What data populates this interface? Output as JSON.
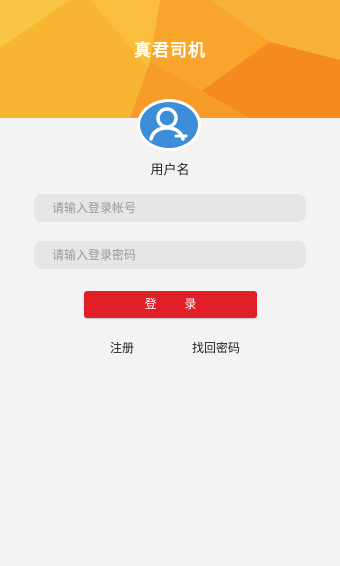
{
  "app_title": "真君司机",
  "avatar": {
    "icon": "user-avatar-icon"
  },
  "username_label": "用户名",
  "form": {
    "account_placeholder": "请输入登录帐号",
    "password_placeholder": "请输入登录密码",
    "login_label": "登 录"
  },
  "links": {
    "register": "注册",
    "forgot_password": "找回密码"
  },
  "colors": {
    "header_yellow": "#f7b531",
    "header_orange": "#f68f24",
    "avatar_blue": "#3d8dd8",
    "login_red": "#e11f26",
    "background": "#f3f3f3"
  }
}
